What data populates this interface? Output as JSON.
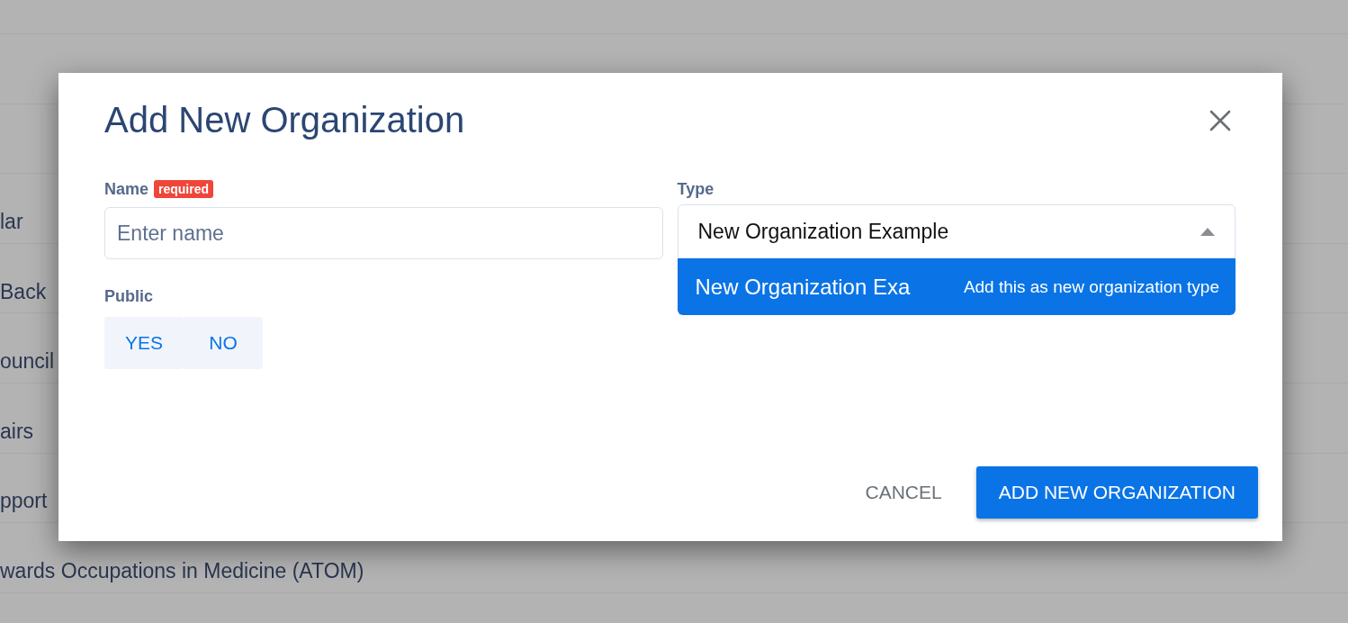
{
  "background_list": {
    "rows": [
      "",
      "",
      "",
      "lar",
      "Back",
      "ouncil",
      "airs",
      "pport",
      "wards Occupations in Medicine (ATOM)"
    ]
  },
  "dialog": {
    "title": "Add New Organization",
    "name_field": {
      "label": "Name",
      "badge": "required",
      "placeholder": "Enter name"
    },
    "public": {
      "label": "Public",
      "options": [
        {
          "label": "YES",
          "selected": false
        },
        {
          "label": "NO",
          "selected": false
        }
      ]
    },
    "type_field": {
      "label": "Type",
      "value": "New Organization Example",
      "expanded": true,
      "options": [
        {
          "label": "New Organization Exa",
          "hint": "Add this as new organization type",
          "selected": true
        }
      ]
    },
    "buttons": [
      {
        "label": "CANCEL",
        "kind": "text"
      },
      {
        "label": "ADD NEW ORGANIZATION",
        "kind": "primary"
      }
    ]
  }
}
